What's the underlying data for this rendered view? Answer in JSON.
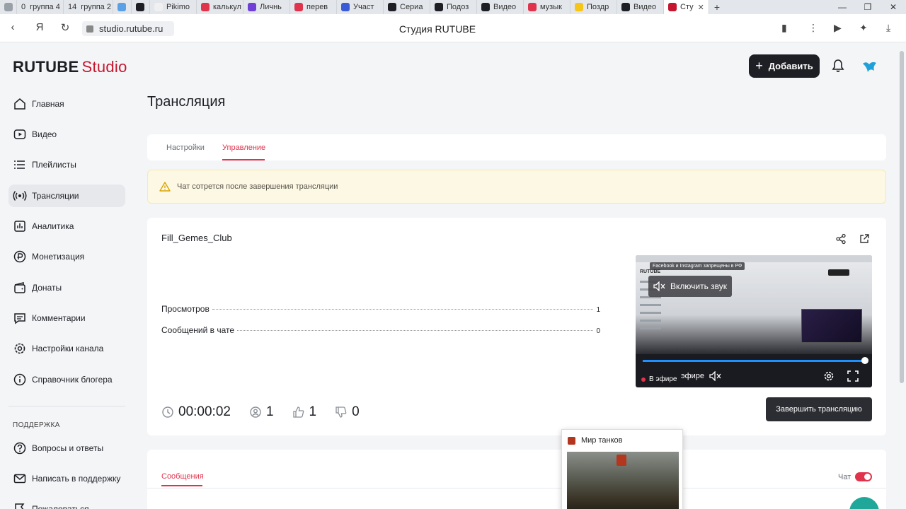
{
  "browser": {
    "tabs": [
      {
        "label": "0",
        "color": "#9aa0a8"
      },
      {
        "label": "группа 4",
        "prefix": "0",
        "color": "#9aa0a8"
      },
      {
        "label": "группа 2",
        "prefix": "14",
        "color": "#9aa0a8"
      },
      {
        "label": "",
        "color": "#5aa0e6"
      },
      {
        "label": "",
        "color": "#1d1f24"
      },
      {
        "label": "Pikimo",
        "color": "#f0f0f0"
      },
      {
        "label": "калькул",
        "color": "#e0344d"
      },
      {
        "label": "Личнь",
        "color": "#6f3fd8"
      },
      {
        "label": "перев",
        "color": "#e0344d"
      },
      {
        "label": "Участ",
        "color": "#3a5bd8"
      },
      {
        "label": "Сериа",
        "color": "#1d1f24"
      },
      {
        "label": "Подоз",
        "color": "#1d1f24"
      },
      {
        "label": "Видео",
        "color": "#1d1f24"
      },
      {
        "label": "музык",
        "color": "#e0344d"
      },
      {
        "label": "Поздр",
        "color": "#f5c518"
      },
      {
        "label": "Видео",
        "color": "#1d1f24"
      },
      {
        "label": "Сту",
        "color": "#c5162f",
        "active": true
      }
    ],
    "url": "studio.rutube.ru",
    "page_title": "Студия RUTUBE"
  },
  "header": {
    "logo_main": "RUTUBE",
    "logo_accent": "Studio",
    "add_button": "Добавить"
  },
  "sidebar": {
    "items": [
      {
        "label": "Главная",
        "icon": "home-icon"
      },
      {
        "label": "Видео",
        "icon": "video-icon"
      },
      {
        "label": "Плейлисты",
        "icon": "playlist-icon"
      },
      {
        "label": "Трансляции",
        "icon": "broadcast-icon",
        "active": true
      },
      {
        "label": "Аналитика",
        "icon": "analytics-icon"
      },
      {
        "label": "Монетизация",
        "icon": "ruble-icon"
      },
      {
        "label": "Донаты",
        "icon": "wallet-icon"
      },
      {
        "label": "Комментарии",
        "icon": "comment-icon"
      },
      {
        "label": "Настройки канала",
        "icon": "gear-icon"
      },
      {
        "label": "Справочник блогера",
        "icon": "info-icon"
      }
    ],
    "support_title": "ПОДДЕРЖКА",
    "support_items": [
      {
        "label": "Вопросы и ответы",
        "icon": "question-icon"
      },
      {
        "label": "Написать в поддержку",
        "icon": "mail-icon"
      },
      {
        "label": "Пожаловаться",
        "icon": "flag-icon"
      }
    ]
  },
  "main": {
    "title": "Трансляция",
    "tabs": [
      {
        "label": "Настройки"
      },
      {
        "label": "Управление",
        "active": true
      }
    ],
    "warning": "Чат сотрется после завершения трансляции",
    "stream": {
      "name": "Fill_Gemes_Club",
      "stats": [
        {
          "label": "Просмотров",
          "value": "1"
        },
        {
          "label": "Сообщений в чате",
          "value": "0"
        }
      ],
      "player": {
        "fb_note": "Facebook и Instagram запрещены в РФ",
        "unmute": "Включить звук",
        "live": "В эфире",
        "live_partial": "эфире",
        "progress": 1.0
      },
      "counters": {
        "duration": "00:00:02",
        "viewers": "1",
        "likes": "1",
        "dislikes": "0"
      },
      "end_button": "Завершить трансляцию"
    },
    "messages": {
      "tab": "Сообщения",
      "chat_label": "Чат",
      "chat_enabled": true
    }
  },
  "popup": {
    "title": "Мир танков"
  },
  "colors": {
    "accent": "#e0344d",
    "brand": "#c5162f",
    "dark": "#1d1f24"
  }
}
